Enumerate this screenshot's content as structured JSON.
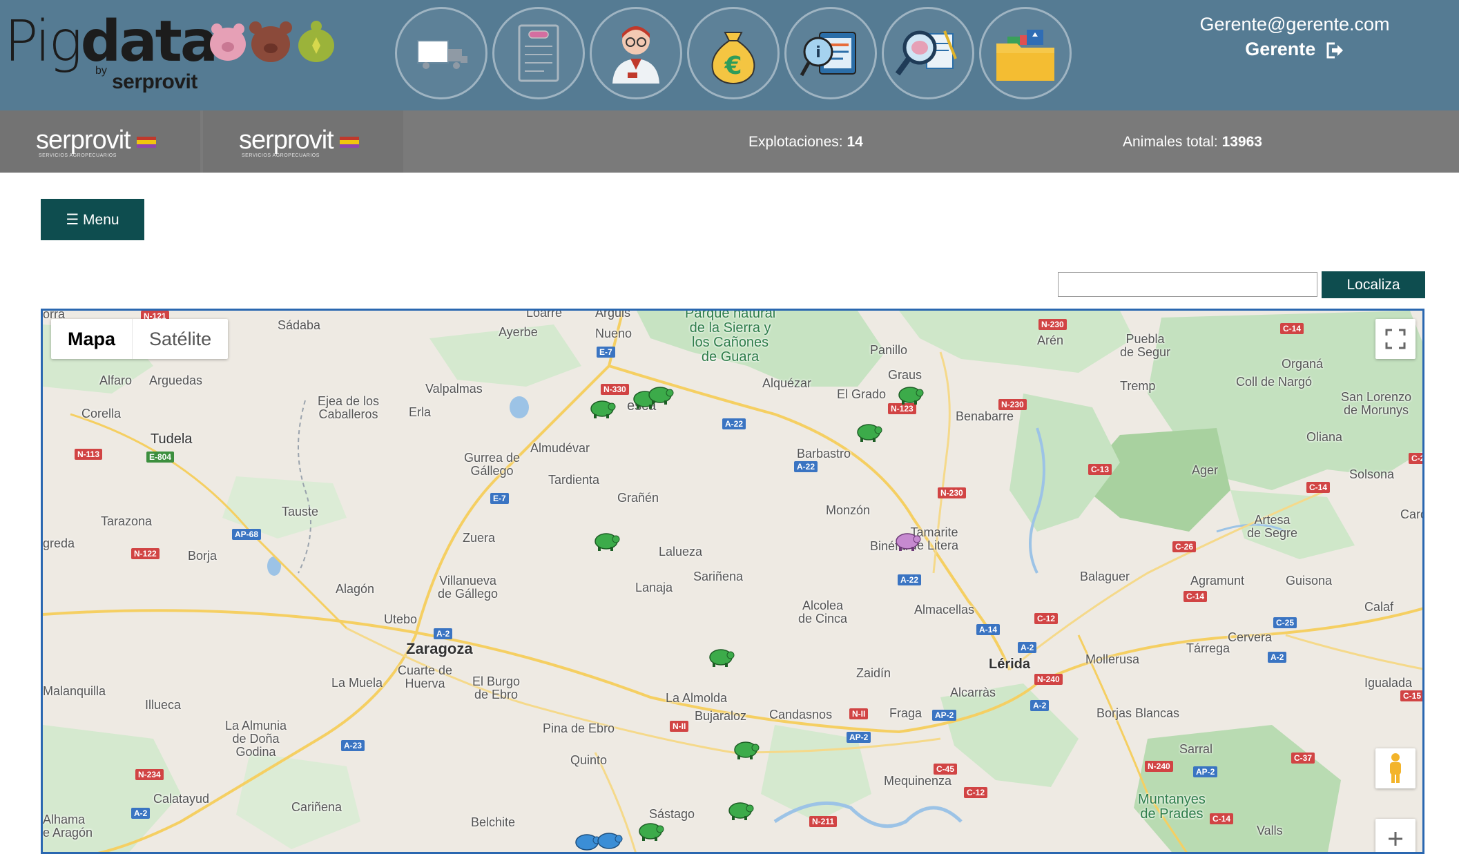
{
  "header": {
    "logo_light": "Pig",
    "logo_bold": "data",
    "logo_by": "by",
    "logo_brand": "serprovit",
    "user_email": "Gerente@gerente.com",
    "user_role": "Gerente",
    "nav_icons": [
      "truck-icon",
      "document-icon",
      "veterinarian-icon",
      "money-bag-icon",
      "info-display-icon",
      "search-pig-icon",
      "folder-icon"
    ]
  },
  "brand_bar": {
    "brand1": "serprovit",
    "brand1_sub": "SERVICIOS AGROPECUARIOS",
    "brand2": "serprovit",
    "brand2_sub": "SERVICIOS AGROPECUARIOS",
    "explotaciones_label": "Explotaciones:",
    "explotaciones_value": "14",
    "animales_label": "Animales total:",
    "animales_value": "13963"
  },
  "menu": {
    "label": "☰ Menu"
  },
  "search": {
    "placeholder": "",
    "button_label": "Localiza"
  },
  "map": {
    "type_map": "Mapa",
    "type_satellite": "Satélite",
    "places": {
      "sadaba": "Sádaba",
      "ayerbe": "Ayerbe",
      "nueno": "Nueno",
      "loarre": "Loarre",
      "arguis": "Arguis",
      "guara": "Parque natural\nde la Sierra y\nlos Cañones\nde Guara",
      "panillo": "Panillo",
      "arén": "Arén",
      "puebla": "Puebla\nde Segur",
      "orgaña": "Organá",
      "coll": "Coll de Nargó",
      "tremp": "Tremp",
      "sanlorenzo": "San Lorenzo\nde Morunys",
      "alfaro": "Alfaro",
      "arguedas": "Arguedas",
      "corella": "Corella",
      "tudela": "Tudela",
      "ejea": "Ejea de los\nCaballeros",
      "erla": "Erla",
      "valpalmas": "Valpalmas",
      "huesca": "esca",
      "alquezar": "Alquézar",
      "grado": "El Grado",
      "graus": "Graus",
      "benabarre": "Benabarre",
      "gurrea": "Gurrea de\nGállego",
      "almudevar": "Almudévar",
      "barbastro": "Barbastro",
      "oliana": "Oliana",
      "ager": "Ager",
      "solsona": "Solsona",
      "tardienta": "Tardienta",
      "granen": "Grañén",
      "monzon": "Monzón",
      "tarazona": "Tarazona",
      "tauste": "Tauste",
      "tamarite": "Tamarite\nde Litera",
      "binefar": "Binéfar",
      "artesa": "Artesa\nde Segre",
      "cardona": "Cardon",
      "greda": "greda",
      "borja": "Borja",
      "zuera": "Zuera",
      "lalueza": "Lalueza",
      "sarinena": "Sariñena",
      "lanaja": "Lanaja",
      "balaguer": "Balaguer",
      "agramunt": "Agramunt",
      "guisona": "Guisona",
      "calaf": "Calaf",
      "alagon": "Alagón",
      "villanueva": "Villanueva\nde Gállego",
      "alcolea": "Alcolea\nde Cinca",
      "almacellas": "Almacellas",
      "cervera": "Cervera",
      "utebo": "Utebo",
      "zaragoza": "Zaragoza",
      "tarrega": "Tárrega",
      "lerida": "Lérida",
      "mollerusa": "Mollerusa",
      "cuarte": "Cuarte de\nHuerva",
      "lamuela": "La Muela",
      "elburgo": "El Burgo\nde Ebro",
      "zaidin": "Zaidín",
      "igualada": "Igualada",
      "malanquilla": "Malanquilla",
      "almolda": "La Almolda",
      "alcarras": "Alcarràs",
      "illueca": "Illueca",
      "almunia": "La Almunia\nde Doña\nGodina",
      "pina": "Pina de Ebro",
      "bujaraloz": "Bujaraloz",
      "candasnos": "Candasnos",
      "fraga": "Fraga",
      "borjas": "Borjas Blancas",
      "quinto": "Quinto",
      "sarral": "Sarral",
      "mequinenza": "Mequinenza",
      "calatayud": "Calatayud",
      "carinena": "Cariñena",
      "sastago": "Sástago",
      "belchite": "Belchite",
      "muntanyes": "Muntanyes\nde Prades",
      "valls": "Valls",
      "alhama": "Alhama\ne Aragón",
      "orra": "orra"
    },
    "roads": {
      "n121": "N-121",
      "n230a": "N-230",
      "c14a": "C-14",
      "e7a": "E-7",
      "n330": "N-330",
      "n123": "N-123",
      "n230b": "N-230",
      "a22a": "A-22",
      "n113": "N-113",
      "e804": "E-804",
      "a22b": "A-22",
      "c13": "C-13",
      "c2": "C-2",
      "c14b": "C-14",
      "e7b": "E-7",
      "n230c": "N-230",
      "ap68": "AP-68",
      "n122": "N-122",
      "c26": "C-26",
      "a22c": "A-22",
      "c14c": "C-14",
      "c12a": "C-12",
      "c25": "C-25",
      "a2a": "A-2",
      "a14": "A-14",
      "a2b": "A-2",
      "a2c": "A-2",
      "n240a": "N-240",
      "a2d": "A-2",
      "c15": "C-15",
      "nii": "N-II",
      "n2": "N-II",
      "ap2a": "AP-2",
      "a23": "A-23",
      "ap2b": "AP-2",
      "c45": "C-45",
      "c12b": "C-12",
      "n240b": "N-240",
      "ap2c": "AP-2",
      "c37": "C-37",
      "n234": "N-234",
      "n211": "N-211",
      "a2e": "A-2",
      "c14d": "C-14"
    }
  }
}
